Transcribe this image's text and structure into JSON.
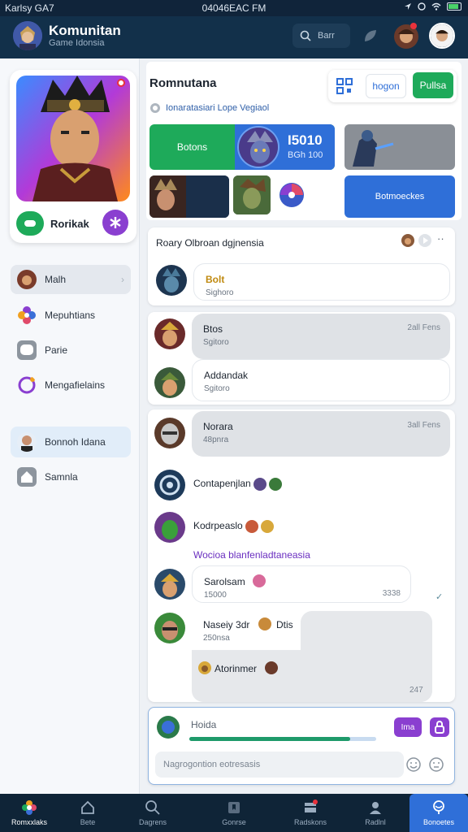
{
  "status": {
    "carrier": "Karlsy GA7",
    "time": "04046EAC FM"
  },
  "appbar": {
    "title": "Komunitan",
    "subtitle": "Game Idonsia",
    "search_label": "Barr"
  },
  "profile": {
    "button_label": "Rorikak"
  },
  "sidebar": {
    "items": [
      {
        "label": "Malh"
      },
      {
        "label": "Mepuhtians"
      },
      {
        "label": "Parie"
      },
      {
        "label": "Mengafielains"
      },
      {
        "label": "Bonnoh Idana"
      },
      {
        "label": "Samnla"
      }
    ]
  },
  "header": {
    "title": "Romnutana",
    "tab_label": "hogon",
    "action_label": "Pullsa",
    "subtitle": "Ionaratasiari Lope Vegiaol"
  },
  "tiles": {
    "green_label": "Botons",
    "score": "I5010",
    "score_sub": "BGh 100",
    "blue_label": "Botmoeckes"
  },
  "feed": {
    "group_title": "Roary Olbroan dgjnensia",
    "posts": [
      {
        "name": "Bolt",
        "meta": "Sighoro",
        "time": ""
      },
      {
        "name": "Btos",
        "meta": "Sgitoro",
        "time": "2all Fens"
      },
      {
        "name": "Addandak",
        "meta": "Sgitoro",
        "time": ""
      },
      {
        "name": "Norara",
        "meta": "48pnra",
        "time": "3all Fens"
      },
      {
        "name": "Contapenjlan",
        "meta": "",
        "time": ""
      },
      {
        "name": "Kodrpeaslo",
        "meta": "",
        "time": ""
      },
      {
        "name": "Sarolsam",
        "meta": "15000",
        "time": "3338"
      },
      {
        "name": "Naseiy 3dr",
        "meta": "250nsa",
        "time": "247"
      },
      {
        "name": "Atorinmer",
        "meta": "",
        "time": ""
      }
    ],
    "link_text": "Wocioa blanfenladtaneasia",
    "reply_extra": "Dtis"
  },
  "composer": {
    "name": "Hoida",
    "progress": 0.86,
    "btn1": "Ima",
    "placeholder": "Nagrogontion eotresasis"
  },
  "bottom_nav": [
    {
      "label": "Romxxlaks",
      "icon": "home-flower-icon"
    },
    {
      "label": "Bete",
      "icon": "house-icon"
    },
    {
      "label": "Dagrens",
      "icon": "search-icon"
    },
    {
      "label": "Gonrse",
      "icon": "bookmark-icon"
    },
    {
      "label": "Radskons",
      "icon": "inbox-icon"
    },
    {
      "label": "Radlnl",
      "icon": "user-icon"
    },
    {
      "label": "Bonoetes",
      "icon": "lotus-icon"
    }
  ],
  "colors": {
    "accent_green": "#1eaa5a",
    "accent_blue": "#2f6fd8",
    "accent_purple": "#8a3fd0",
    "dark": "#12304a"
  }
}
